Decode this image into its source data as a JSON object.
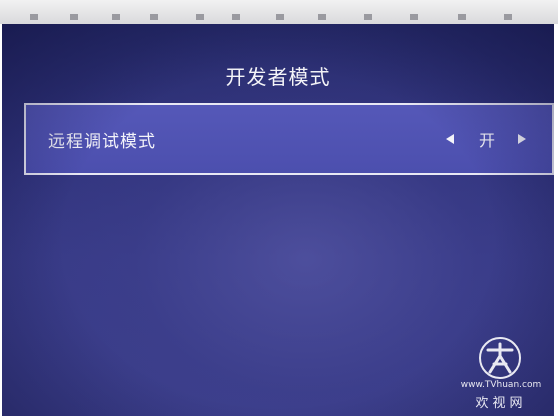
{
  "screen": {
    "title": "开发者模式"
  },
  "menu": {
    "items": [
      {
        "label": "远程调试模式",
        "value": "开",
        "selected": true
      }
    ]
  },
  "watermark": {
    "url": "www.TVhuan.com",
    "name": "欢视网"
  },
  "icons": {
    "left": "triangle-left-icon",
    "right": "triangle-right-icon",
    "logo": "tvhuan-logo-icon"
  },
  "colors": {
    "background": "#2f327a",
    "selected_row": "#5054b4",
    "row_border": "#e8e8f4",
    "text": "#f4f4fa"
  }
}
